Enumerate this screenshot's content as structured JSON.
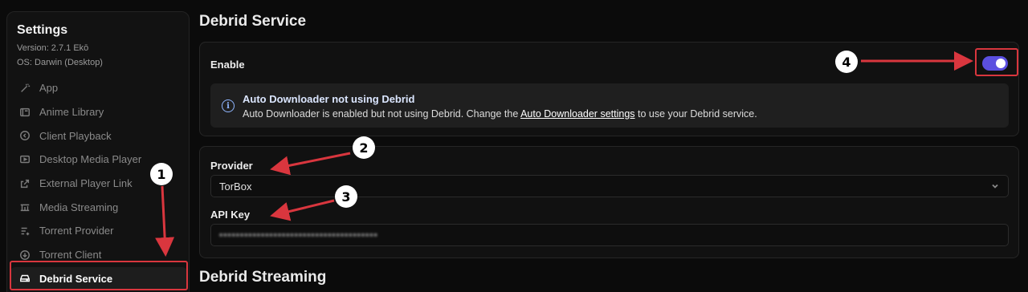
{
  "sidebar": {
    "title": "Settings",
    "version": "Version: 2.7.1 Ekō",
    "os": "OS: Darwin (Desktop)",
    "items": [
      {
        "label": "App",
        "icon": "magic-wand-icon"
      },
      {
        "label": "Anime Library",
        "icon": "library-icon"
      },
      {
        "label": "Client Playback",
        "icon": "playback-icon"
      },
      {
        "label": "Desktop Media Player",
        "icon": "media-player-icon"
      },
      {
        "label": "External Player Link",
        "icon": "external-link-icon"
      },
      {
        "label": "Media Streaming",
        "icon": "streaming-icon"
      },
      {
        "label": "Torrent Provider",
        "icon": "list-icon"
      },
      {
        "label": "Torrent Client",
        "icon": "download-icon"
      },
      {
        "label": "Debrid Service",
        "icon": "drive-icon",
        "active": true
      }
    ]
  },
  "main": {
    "section_title": "Debrid Service",
    "enable_label": "Enable",
    "enabled": true,
    "alert": {
      "title": "Auto Downloader not using Debrid",
      "body_prefix": "Auto Downloader is enabled but not using Debrid. Change the ",
      "link": "Auto Downloader settings",
      "body_suffix": " to use your Debrid service."
    },
    "provider_label": "Provider",
    "provider_value": "TorBox",
    "api_key_label": "API Key",
    "api_key_value": "••••••••••••••••••••••••••••••••••••••",
    "next_section_title": "Debrid Streaming"
  },
  "annotations": {
    "badges": [
      "1",
      "2",
      "3",
      "4"
    ],
    "color": "#d9363e"
  },
  "colors": {
    "accent": "#5b4fe0",
    "highlight": "#d9363e"
  }
}
